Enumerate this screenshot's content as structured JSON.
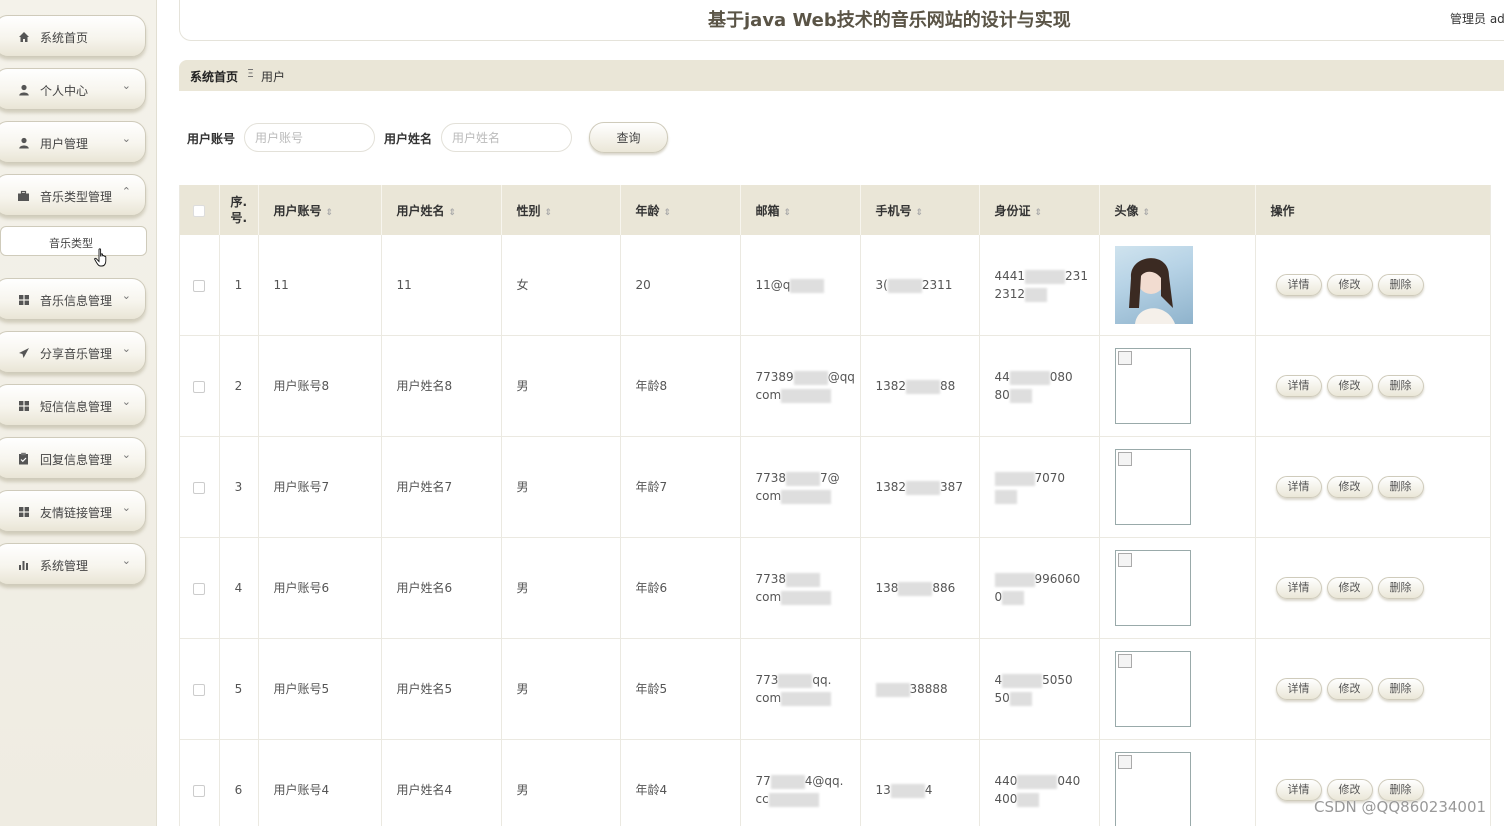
{
  "sidebar": {
    "items": [
      {
        "label": "系统首页",
        "icon": "home-icon",
        "chevron": ""
      },
      {
        "label": "个人中心",
        "icon": "user-icon",
        "chevron": "⌄"
      },
      {
        "label": "用户管理",
        "icon": "user-icon",
        "chevron": "⌄"
      },
      {
        "label": "音乐类型管理",
        "icon": "briefcase-icon",
        "chevron": "⌃"
      },
      {
        "label": "音乐信息管理",
        "icon": "grid-icon",
        "chevron": "⌄"
      },
      {
        "label": "分享音乐管理",
        "icon": "send-icon",
        "chevron": "⌄"
      },
      {
        "label": "短信信息管理",
        "icon": "grid-icon",
        "chevron": "⌄"
      },
      {
        "label": "回复信息管理",
        "icon": "clipboard-icon",
        "chevron": "⌄"
      },
      {
        "label": "友情链接管理",
        "icon": "grid-icon",
        "chevron": "⌄"
      },
      {
        "label": "系统管理",
        "icon": "bar-chart-icon",
        "chevron": "⌄"
      }
    ],
    "submenu": {
      "label": "音乐类型"
    }
  },
  "header": {
    "title": "基于java Web技术的音乐网站的设计与实现",
    "admin": "管理员 ad"
  },
  "breadcrumb": {
    "home": "系统首页",
    "separator": "Ξ",
    "current": "用户"
  },
  "search": {
    "account_label": "用户账号",
    "account_placeholder": "用户账号",
    "name_label": "用户姓名",
    "name_placeholder": "用户姓名",
    "query_label": "查询"
  },
  "table": {
    "headers": {
      "index": "序.号.",
      "account": "用户账号",
      "name": "用户姓名",
      "gender": "性别",
      "age": "年龄",
      "email": "邮箱",
      "phone": "手机号",
      "id_card": "身份证",
      "avatar": "头像",
      "actions": "操作"
    },
    "sort_icon": "⇕",
    "rows": [
      {
        "index": "1",
        "account": "11",
        "name": "11",
        "gender": "女",
        "age": "20",
        "email_a": "11@q",
        "email_b": "",
        "phone_a": "3(",
        "phone_b": "2311",
        "id_a": "4441",
        "id_b": "231",
        "id_c": "2312",
        "photo": true
      },
      {
        "index": "2",
        "account": "用户账号8",
        "name": "用户姓名8",
        "gender": "男",
        "age": "年龄8",
        "email_a": "77389",
        "email_b": "@qq",
        "email_c": "com",
        "phone_a": "1382",
        "phone_b": "88",
        "id_a": "44",
        "id_b": "080",
        "id_c": "80",
        "photo": false
      },
      {
        "index": "3",
        "account": "用户账号7",
        "name": "用户姓名7",
        "gender": "男",
        "age": "年龄7",
        "email_a": "7738",
        "email_b": "7@",
        "email_c": "com",
        "phone_a": "1382",
        "phone_b": "387",
        "id_a": "",
        "id_b": "7070",
        "id_c": "",
        "photo": false
      },
      {
        "index": "4",
        "account": "用户账号6",
        "name": "用户姓名6",
        "gender": "男",
        "age": "年龄6",
        "email_a": "7738",
        "email_b": "",
        "email_c": "com",
        "phone_a": "138",
        "phone_b": "886",
        "id_a": "",
        "id_b": "996060",
        "id_c": "0",
        "photo": false
      },
      {
        "index": "5",
        "account": "用户账号5",
        "name": "用户姓名5",
        "gender": "男",
        "age": "年龄5",
        "email_a": "773",
        "email_b": "qq.",
        "email_c": "com",
        "phone_a": "",
        "phone_b": "38888",
        "id_a": "4",
        "id_b": "5050",
        "id_c": "50",
        "photo": false
      },
      {
        "index": "6",
        "account": "用户账号4",
        "name": "用户姓名4",
        "gender": "男",
        "age": "年龄4",
        "email_a": "77",
        "email_b": "4@qq.",
        "email_c": "cc",
        "phone_a": "13",
        "phone_b": "4",
        "id_a": "440",
        "id_b": "040",
        "id_c": "400",
        "photo": false
      }
    ],
    "actions": {
      "detail": "详情",
      "edit": "修改",
      "delete": "删除"
    }
  },
  "watermark": "CSDN @QQ860234001",
  "colors": {
    "accent": "#eae6d7",
    "title": "#5a5446",
    "sidebar_bg": "#f4f2ea"
  }
}
